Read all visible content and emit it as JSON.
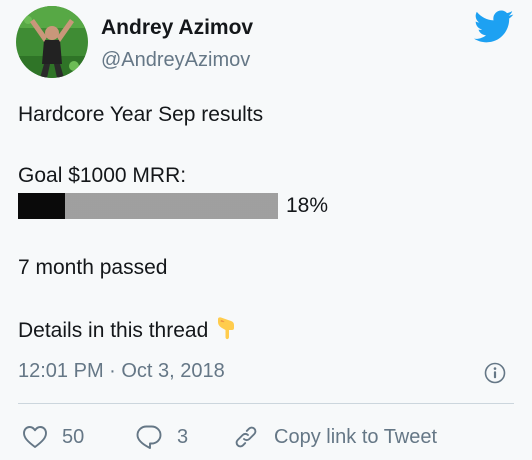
{
  "author": {
    "display_name": "Andrey Azimov",
    "handle": "@AndreyAzimov"
  },
  "tweet": {
    "line1": "Hardcore Year Sep results",
    "goal": "Goal $1000 MRR:",
    "progress_fraction": 0.18,
    "progress_label": "18%",
    "months": "7 month passed",
    "details": "Details in this thread",
    "details_emoji": "pointing-down-hand-icon"
  },
  "meta": {
    "timestamp": "12:01 PM · Oct 3, 2018"
  },
  "actions": {
    "likes": "50",
    "replies": "3",
    "copy_link": "Copy link to Tweet"
  },
  "colors": {
    "twitter_blue": "#1da1f2",
    "secondary_text": "#657786",
    "primary_text": "#14171a",
    "background": "#f7f9fa",
    "divider": "#ccd6dd",
    "emoji_yellow": "#ffcc4d"
  }
}
